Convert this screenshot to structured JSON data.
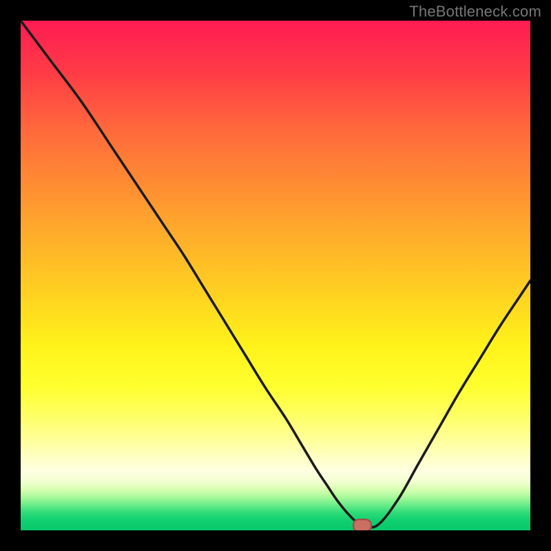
{
  "watermark": "TheBottleneck.com",
  "colors": {
    "frame_bg": "#000000",
    "curve_stroke": "#1b1b1b",
    "marker_fill": "#cc6f63",
    "marker_border": "#a04d47",
    "gradient_top": "#ff1b52",
    "gradient_mid": "#fff31a",
    "gradient_bottom": "#07c96b"
  },
  "chart_data": {
    "type": "line",
    "title": "",
    "xlabel": "",
    "ylabel": "",
    "xlim": [
      0,
      100
    ],
    "ylim": [
      0,
      100
    ],
    "grid": false,
    "series": [
      {
        "name": "bottleneck-curve",
        "x": [
          0,
          6,
          12,
          18,
          24,
          28,
          32,
          36,
          40,
          44,
          48,
          52,
          55,
          58,
          60,
          62,
          64,
          66,
          67,
          70,
          74,
          78,
          82,
          86,
          90,
          94,
          98,
          100
        ],
        "y": [
          100,
          92,
          84,
          75,
          66,
          60,
          54,
          47.5,
          41,
          34.5,
          28,
          22,
          17,
          12,
          9,
          6,
          3.5,
          1.5,
          1,
          1,
          6,
          13,
          20,
          27,
          33.5,
          40,
          46,
          49
        ]
      }
    ],
    "marker": {
      "x": 67,
      "y": 1,
      "shape": "pill"
    },
    "annotations": []
  }
}
